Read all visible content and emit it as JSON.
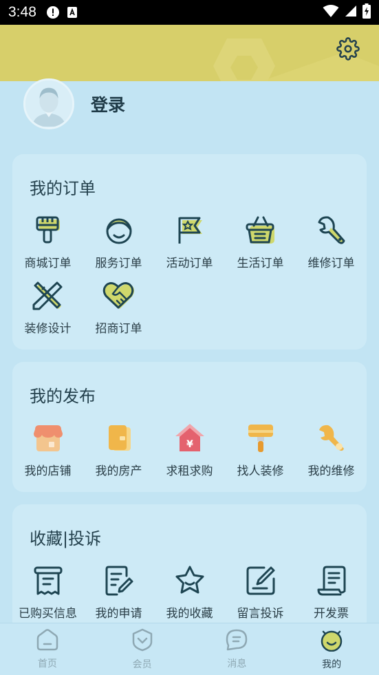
{
  "status_bar": {
    "time": "3:48"
  },
  "profile": {
    "login_label": "登录"
  },
  "orders": {
    "title": "我的订单",
    "items": [
      {
        "label": "商城订单",
        "icon": "brush-icon"
      },
      {
        "label": "服务订单",
        "icon": "person-face-icon"
      },
      {
        "label": "活动订单",
        "icon": "flag-icon"
      },
      {
        "label": "生活订单",
        "icon": "basket-icon"
      },
      {
        "label": "维修订单",
        "icon": "wrench-icon"
      },
      {
        "label": "装修设计",
        "icon": "ruler-pencil-icon"
      },
      {
        "label": "招商订单",
        "icon": "handshake-heart-icon"
      }
    ]
  },
  "publish": {
    "title": "我的发布",
    "items": [
      {
        "label": "我的店铺",
        "icon": "shop-icon"
      },
      {
        "label": "我的房产",
        "icon": "wallet-icon"
      },
      {
        "label": "求租求购",
        "icon": "house-yen-icon"
      },
      {
        "label": "找人装修",
        "icon": "paint-roller-icon"
      },
      {
        "label": "我的维修",
        "icon": "wrench-icon"
      }
    ]
  },
  "favorites": {
    "title": "收藏|投诉",
    "items": [
      {
        "label": "已购买信息",
        "icon": "receipt-icon"
      },
      {
        "label": "我的申请",
        "icon": "edit-document-icon"
      },
      {
        "label": "我的收藏",
        "icon": "star-icon"
      },
      {
        "label": "留言投诉",
        "icon": "edit-square-icon"
      },
      {
        "label": "开发票",
        "icon": "invoice-scroll-icon"
      }
    ]
  },
  "tabbar": {
    "items": [
      {
        "label": "首页",
        "icon": "home-icon"
      },
      {
        "label": "会员",
        "icon": "member-shield-icon"
      },
      {
        "label": "消息",
        "icon": "message-icon"
      },
      {
        "label": "我的",
        "icon": "smiley-face-icon"
      }
    ],
    "active": "我的"
  },
  "colors": {
    "background": "#c2e4f3",
    "header": "#d7cf6a",
    "accent_yellow": "#cfd86c",
    "icon_dark": "#1e4552",
    "red_accent": "#e4626e",
    "orange_accent": "#f0b64a"
  }
}
